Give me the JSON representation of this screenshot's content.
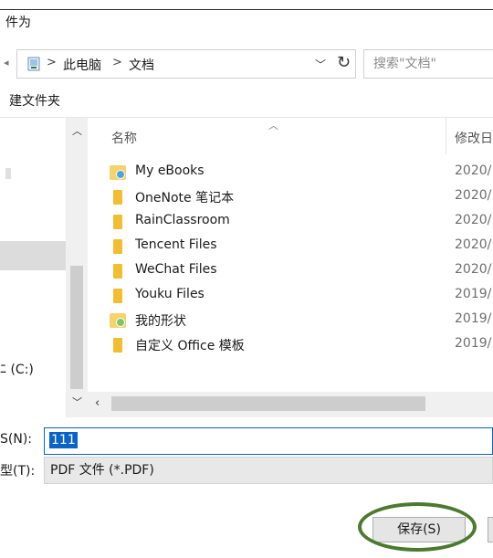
{
  "window": {
    "title_fragment": "件为"
  },
  "address_bar": {
    "crumbs": [
      "此电脑",
      "文档"
    ],
    "separator": ">",
    "search_placeholder": "搜索\"文档\""
  },
  "toolbar": {
    "new_folder_label": "建文件夹"
  },
  "nav_pane": {
    "drive_label": "(C:)",
    "drive_prefix": "ﾆ"
  },
  "list": {
    "columns": {
      "name": "名称",
      "modified": "修改日"
    },
    "rows": [
      {
        "name": "My eBooks",
        "date": "2020/",
        "icon": "special-folder-icon"
      },
      {
        "name": "OneNote 笔记本",
        "date": "2020/",
        "icon": "folder-icon"
      },
      {
        "name": "RainClassroom",
        "date": "2020/",
        "icon": "folder-icon"
      },
      {
        "name": "Tencent Files",
        "date": "2020/",
        "icon": "folder-icon"
      },
      {
        "name": "WeChat Files",
        "date": "2020/",
        "icon": "folder-icon"
      },
      {
        "name": "Youku Files",
        "date": "2019/",
        "icon": "folder-icon"
      },
      {
        "name": "我的形状",
        "date": "2019/",
        "icon": "shape-folder-icon"
      },
      {
        "name": "自定义 Office 模板",
        "date": "2019/",
        "icon": "folder-icon"
      }
    ]
  },
  "form": {
    "filename_label": "S(N):",
    "filename_value": "111",
    "filetype_label": "型(T):",
    "filetype_value": "PDF 文件 (*.PDF)"
  },
  "buttons": {
    "save_label": "保存(S)"
  },
  "colors": {
    "selection_blue": "#0a64c8",
    "folder_yellow": "#f2bd30",
    "highlight_ring": "#4b7a2e"
  }
}
